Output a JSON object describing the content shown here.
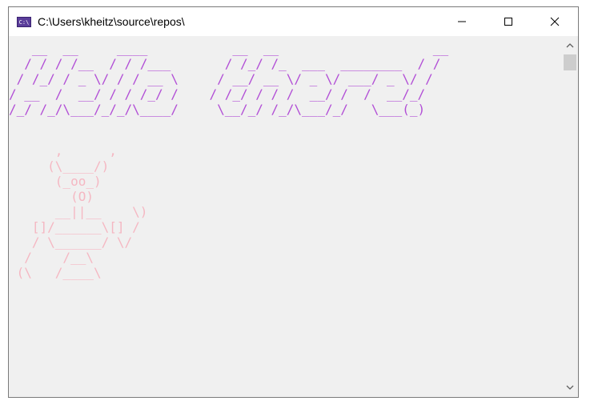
{
  "window": {
    "title": "C:\\Users\\kheitz\\source\\repos\\",
    "app_icon_text": "C:\\",
    "icon_names": [
      "console-app-icon",
      "minimize-icon",
      "maximize-icon",
      "close-icon",
      "scroll-up-icon",
      "scroll-down-icon"
    ]
  },
  "console": {
    "banner_color": "#b24fd6",
    "art_color": "#f5b7c2",
    "banner": "   __  __     ____           __  __                    __\n  / / / /__  / / /___       / /_/ /_  ___  ________  / /\n / /_/ / _ \\/ / / __ \\     / __/ __ \\/ _ \\/ ___/ _ \\/ /\n/ __  /  __/ / / /_/ /    / /_/ / / /  __/ /  /  __/_/\n/_/ /_/\\___/_/_/\\____/     \\__/_/ /_/\\___/_/   \\___(_)",
    "art": "      ,      ,\n     (\\____/)\n      (_oo_)\n        (O)\n      __||__    \\)\n   []/______\\[] /\n   / \\______/ \\/\n  /    /__\\\n (\\   /____\\"
  }
}
